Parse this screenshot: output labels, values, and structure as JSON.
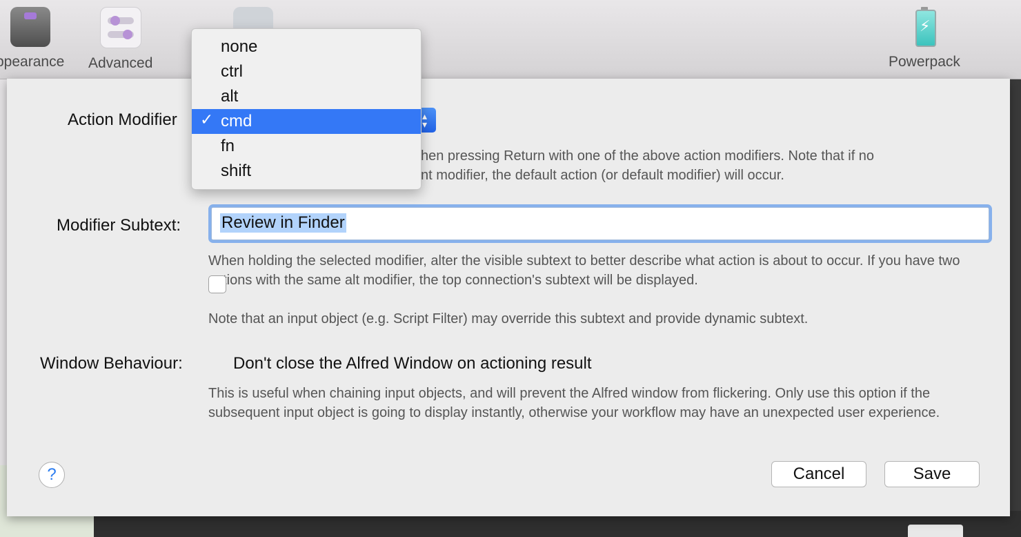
{
  "toolbar": {
    "items": [
      {
        "label": "ppearance",
        "icon": "appearance-icon"
      },
      {
        "label": "Advanced",
        "icon": "advanced-icon"
      },
      {
        "label": "Powerpack",
        "icon": "battery-icon"
      }
    ]
  },
  "action_modifier": {
    "label": "Action Modifier",
    "selected": "cmd",
    "options": [
      "none",
      "ctrl",
      "alt",
      "cmd",
      "fn",
      "shift"
    ],
    "help_line1": "hen pressing Return with one of the above action modifiers. Note that if no",
    "help_line2": "nt modifier, the default action (or default modifier) will occur."
  },
  "modifier_subtext": {
    "label": "Modifier Subtext:",
    "value": "Review in Finder",
    "help1": "When holding the selected modifier, alter the visible subtext to better describe what action is about to occur. If you have two actions with the same alt modifier, the top connection's subtext will be displayed.",
    "help2": "Note that an input object (e.g. Script Filter) may override this subtext and provide dynamic subtext."
  },
  "window_behaviour": {
    "label": "Window Behaviour:",
    "checkbox_label": "Don't close the Alfred Window on actioning result",
    "checked": false,
    "help": "This is useful when chaining input objects, and will prevent the Alfred window from flickering. Only use this option if the subsequent input object is going to display instantly, otherwise your workflow may have an unexpected user experience."
  },
  "buttons": {
    "help": "?",
    "cancel": "Cancel",
    "save": "Save"
  },
  "colors": {
    "accent": "#3478f6",
    "selection": "#b2d3fb"
  }
}
